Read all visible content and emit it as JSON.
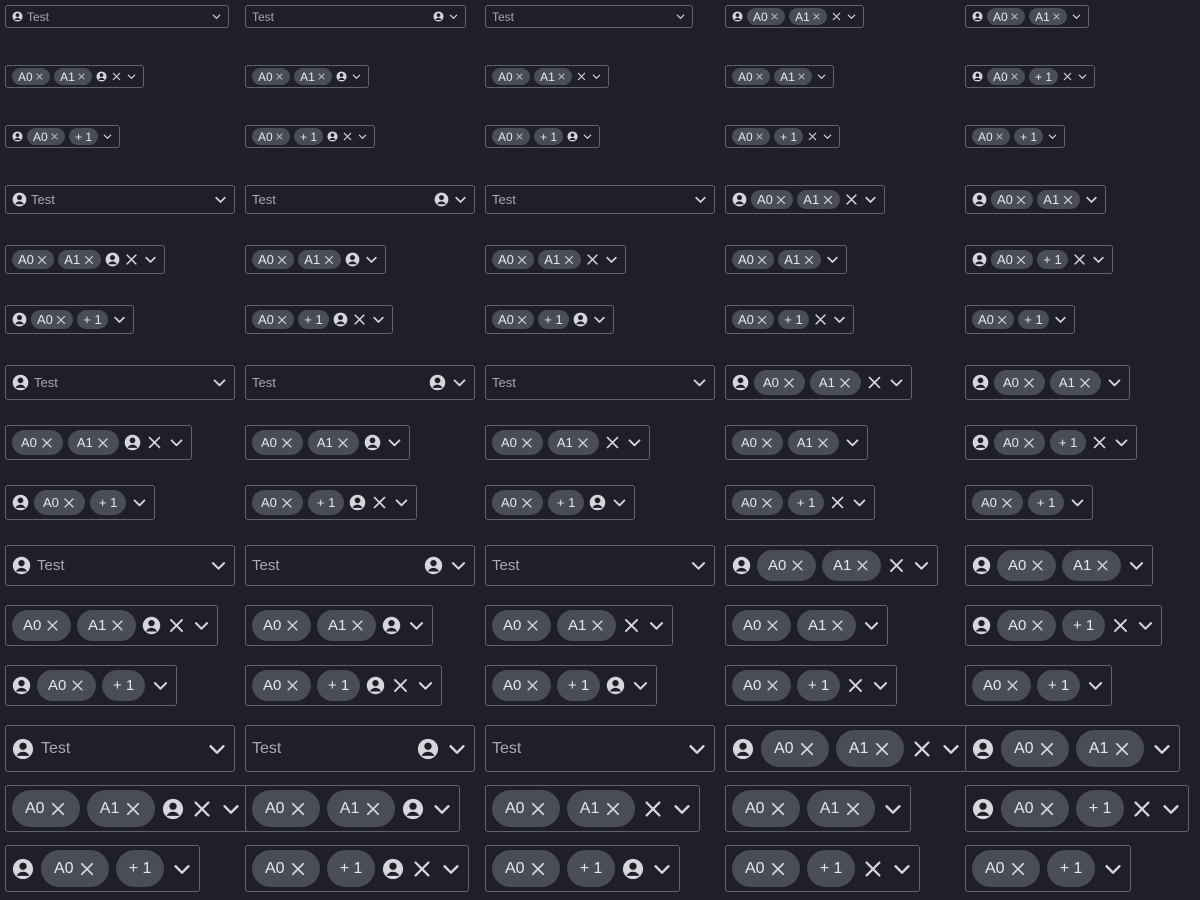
{
  "texts": {
    "placeholder": "Test",
    "tag_a0": "A0",
    "tag_a1": "A1",
    "tag_more": "+ 1"
  },
  "icons": {
    "person": "user-circle-icon",
    "clear": "close-icon",
    "caret": "chevron-down-icon",
    "tag_remove": "close-icon"
  },
  "colors": {
    "background": "#1e1f27",
    "border": "#62646d",
    "tag_bg": "#4a4d58",
    "text": "#d6d7dd",
    "placeholder": "#a8aab2"
  },
  "rows": [
    {
      "size": "xs",
      "cells": [
        "p_full",
        "full_pr",
        "full_plain",
        "p_a0a1_xc",
        "p_a0a1_c"
      ]
    },
    {
      "size": "xs",
      "cells": [
        "a0a1_p_xc",
        "a0a1_p_c",
        "a0a1_xc",
        "a0a1_c",
        "p_a0m_xc"
      ]
    },
    {
      "size": "xs",
      "cells": [
        "p_a0m_c",
        "a0m_p_xc",
        "a0m_p_c",
        "a0m_xc",
        "a0m_c"
      ]
    },
    {
      "size": "sm",
      "cells": [
        "p_full",
        "full_pr",
        "full_plain",
        "p_a0a1_xc",
        "p_a0a1_c"
      ]
    },
    {
      "size": "sm",
      "cells": [
        "a0a1_p_xc",
        "a0a1_p_c",
        "a0a1_xc",
        "a0a1_c",
        "p_a0m_xc"
      ]
    },
    {
      "size": "sm",
      "cells": [
        "p_a0m_c",
        "a0m_p_xc",
        "a0m_p_c",
        "a0m_xc",
        "a0m_c"
      ]
    },
    {
      "size": "md",
      "cells": [
        "p_full",
        "full_pr",
        "full_plain",
        "p_a0a1_xc",
        "p_a0a1_c"
      ]
    },
    {
      "size": "md",
      "cells": [
        "a0a1_p_xc",
        "a0a1_p_c",
        "a0a1_xc",
        "a0a1_c",
        "p_a0m_xc"
      ]
    },
    {
      "size": "md",
      "cells": [
        "p_a0m_c",
        "a0m_p_xc",
        "a0m_p_c",
        "a0m_xc",
        "a0m_c"
      ]
    },
    {
      "size": "lg",
      "cells": [
        "p_full",
        "full_pr",
        "full_plain",
        "p_a0a1_xc",
        "p_a0a1_c"
      ]
    },
    {
      "size": "lg",
      "cells": [
        "a0a1_p_xc",
        "a0a1_p_c",
        "a0a1_xc",
        "a0a1_c",
        "p_a0m_xc"
      ]
    },
    {
      "size": "lg",
      "cells": [
        "p_a0m_c",
        "a0m_p_xc",
        "a0m_p_c",
        "a0m_xc",
        "a0m_c"
      ]
    },
    {
      "size": "xl",
      "cells": [
        "p_full",
        "full_pr",
        "full_plain",
        "p_a0a1_xc",
        "p_a0a1_c"
      ]
    },
    {
      "size": "xl",
      "cells": [
        "a0a1_p_xc",
        "a0a1_p_c",
        "a0a1_xc",
        "a0a1_c",
        "p_a0m_xc"
      ]
    },
    {
      "size": "xl",
      "cells": [
        "p_a0m_c",
        "a0m_p_xc",
        "a0m_p_c",
        "a0m_xc",
        "a0m_c"
      ]
    }
  ]
}
